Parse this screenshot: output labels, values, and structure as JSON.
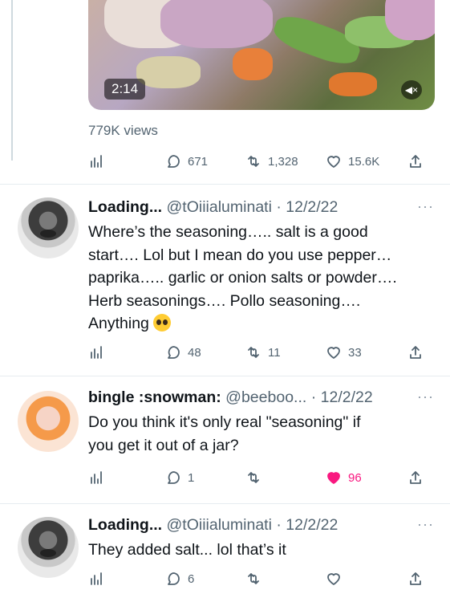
{
  "video": {
    "duration": "2:14",
    "views": "779K views"
  },
  "top_actions": {
    "replies": "671",
    "retweets": "1,328",
    "likes": "15.6K"
  },
  "tweets": [
    {
      "name": "Loading...",
      "handle": "@tOiiialuminati",
      "date": "12/2/22",
      "text_lines": [
        "Where’s the seasoning….. salt is a good",
        "start…. Lol but I mean do you use pepper…",
        "paprika….. garlic or onion salts or powder….",
        "Herb seasonings…. Pollo seasoning….",
        "Anything"
      ],
      "emoji": "pleading-face-emoji",
      "replies": "48",
      "retweets": "11",
      "likes": "33"
    },
    {
      "name": "bingle :snowman:",
      "handle": "@beeboo...",
      "date": "12/2/22",
      "text_lines": [
        "Do you think it's only real \"seasoning\" if",
        "you get it out of a jar?"
      ],
      "replies": "1",
      "retweets": "",
      "likes": "96",
      "like_color": "#f91880"
    },
    {
      "name": "Loading...",
      "handle": "@tOiiialuminati",
      "date": "12/2/22",
      "text_lines": [
        "They added salt... lol that’s it"
      ],
      "replies": "6",
      "retweets": "",
      "likes": ""
    }
  ],
  "sep": " · ",
  "more_label": "···"
}
